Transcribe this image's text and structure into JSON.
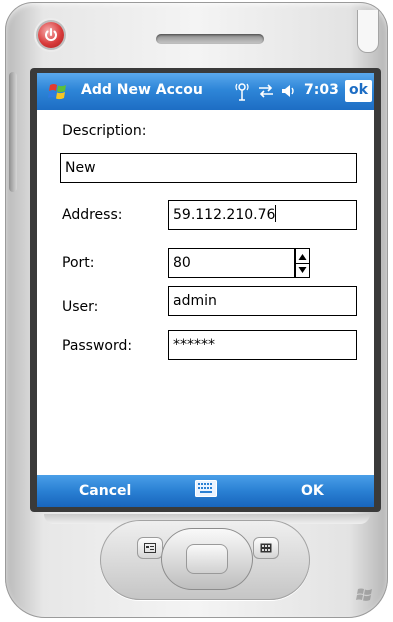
{
  "titlebar": {
    "title": "Add New Accou",
    "time": "7:03",
    "ok_label": "ok"
  },
  "form": {
    "description_label": "Description:",
    "description_value": "New",
    "address_label": "Address:",
    "address_value": "59.112.210.76",
    "port_label": "Port:",
    "port_value": "80",
    "user_label": "User:",
    "user_value": "admin",
    "password_label": "Password:",
    "password_value": "******"
  },
  "menubar": {
    "left_label": "Cancel",
    "right_label": "OK"
  },
  "icons": {
    "start": "windows-flag-icon",
    "signal": "antenna-icon",
    "connectivity": "sync-arrows-icon",
    "volume": "speaker-icon",
    "keyboard": "keyboard-icon",
    "power": "power-icon"
  },
  "colors": {
    "titlebar": "#2e86d8",
    "menubar": "#2a80d3",
    "power_button": "#d93c3c"
  }
}
